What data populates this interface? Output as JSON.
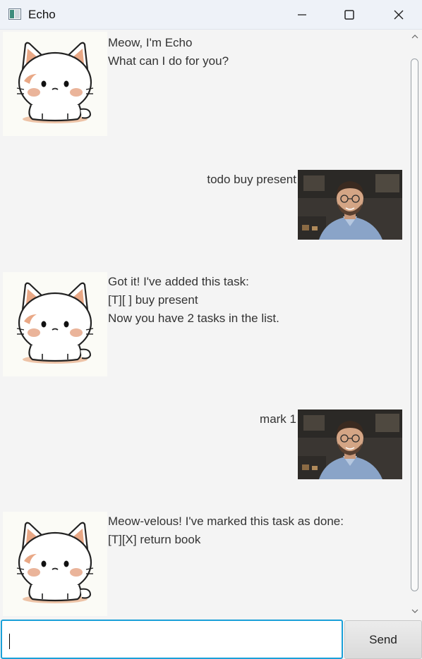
{
  "window": {
    "title": "Echo"
  },
  "dialog": [
    {
      "from": "bot",
      "lines": [
        "Meow, I'm Echo",
        "What can I do for you?"
      ]
    },
    {
      "from": "user",
      "lines": [
        "todo buy present"
      ]
    },
    {
      "from": "bot",
      "lines": [
        "Got it! I've added this task:",
        "[T][ ] buy present",
        "Now you have 2 tasks in the list."
      ]
    },
    {
      "from": "user",
      "lines": [
        "mark 1"
      ]
    },
    {
      "from": "bot",
      "lines": [
        "Meow-velous! I've marked this task as done:",
        "[T][X] return book"
      ]
    }
  ],
  "input": {
    "value": ""
  },
  "send_button": {
    "label": "Send"
  },
  "colors": {
    "accent": "#1aa0d8",
    "background": "#f4f4f4",
    "titlebar": "#eef2f8"
  }
}
